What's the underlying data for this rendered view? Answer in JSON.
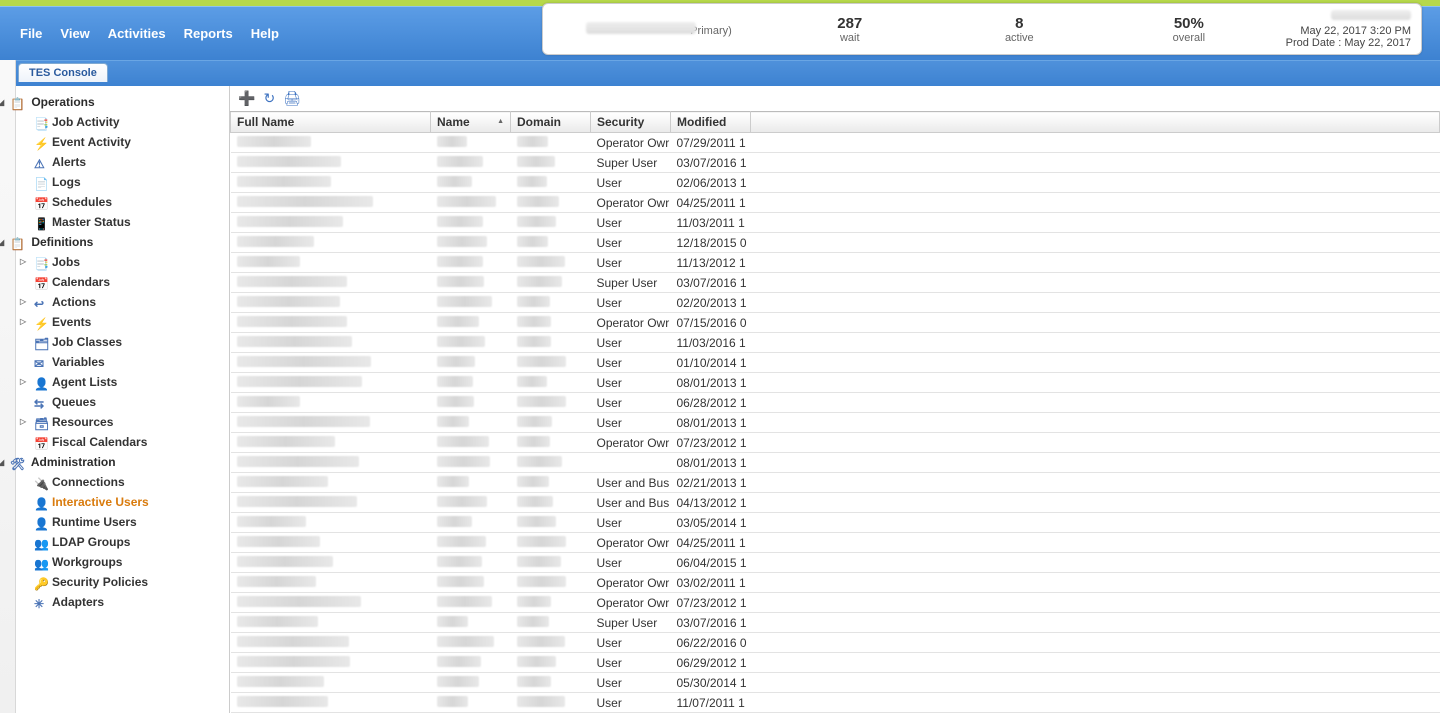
{
  "menu": {
    "file": "File",
    "view": "View",
    "activities": "Activities",
    "reports": "Reports",
    "help": "Help"
  },
  "header": {
    "primary_suffix": "Primary)",
    "wait_num": "287",
    "wait_label": "wait",
    "active_num": "8",
    "active_label": "active",
    "overall_num": "50%",
    "overall_label": "overall",
    "date_line1": "May 22, 2017 3:20 PM",
    "date_line2": "Prod Date : May 22, 2017"
  },
  "tab": "TES Console",
  "tree": {
    "operations": "Operations",
    "job_activity": "Job Activity",
    "event_activity": "Event Activity",
    "alerts": "Alerts",
    "logs": "Logs",
    "schedules": "Schedules",
    "master_status": "Master Status",
    "definitions": "Definitions",
    "jobs": "Jobs",
    "calendars": "Calendars",
    "actions": "Actions",
    "events": "Events",
    "job_classes": "Job Classes",
    "variables": "Variables",
    "agent_lists": "Agent Lists",
    "queues": "Queues",
    "resources": "Resources",
    "fiscal_calendars": "Fiscal Calendars",
    "administration": "Administration",
    "connections": "Connections",
    "interactive_users": "Interactive Users",
    "runtime_users": "Runtime Users",
    "ldap_groups": "LDAP Groups",
    "workgroups": "Workgroups",
    "security_policies": "Security Policies",
    "adapters": "Adapters"
  },
  "columns": {
    "full_name": "Full Name",
    "name": "Name",
    "domain": "Domain",
    "security": "Security",
    "modified": "Modified"
  },
  "rows": [
    {
      "security": "Operator Owr",
      "modified": "07/29/2011 1"
    },
    {
      "security": "Super User",
      "modified": "03/07/2016 1"
    },
    {
      "security": "User",
      "modified": "02/06/2013 1"
    },
    {
      "security": "Operator Owr",
      "modified": "04/25/2011 1"
    },
    {
      "security": "User",
      "modified": "11/03/2011 1"
    },
    {
      "security": "User",
      "modified": "12/18/2015 0"
    },
    {
      "security": "User",
      "modified": "11/13/2012 1"
    },
    {
      "security": "Super User",
      "modified": "03/07/2016 1"
    },
    {
      "security": "User",
      "modified": "02/20/2013 1"
    },
    {
      "security": "Operator Owr",
      "modified": "07/15/2016 0"
    },
    {
      "security": "User",
      "modified": "11/03/2016 1"
    },
    {
      "security": "User",
      "modified": "01/10/2014 1"
    },
    {
      "security": "User",
      "modified": "08/01/2013 1"
    },
    {
      "security": "User",
      "modified": "06/28/2012 1"
    },
    {
      "security": "User",
      "modified": "08/01/2013 1"
    },
    {
      "security": "Operator Owr",
      "modified": "07/23/2012 1"
    },
    {
      "security": "",
      "modified": "08/01/2013 1"
    },
    {
      "security": "User and Bus",
      "modified": "02/21/2013 1"
    },
    {
      "security": "User and Bus",
      "modified": "04/13/2012 1"
    },
    {
      "security": "User",
      "modified": "03/05/2014 1"
    },
    {
      "security": "Operator Owr",
      "modified": "04/25/2011 1"
    },
    {
      "security": "User",
      "modified": "06/04/2015 1"
    },
    {
      "security": "Operator Owr",
      "modified": "03/02/2011 1"
    },
    {
      "security": "Operator Owr",
      "modified": "07/23/2012 1"
    },
    {
      "security": "Super User",
      "modified": "03/07/2016 1"
    },
    {
      "security": "User",
      "modified": "06/22/2016 0"
    },
    {
      "security": "User",
      "modified": "06/29/2012 1"
    },
    {
      "security": "User",
      "modified": "05/30/2014 1"
    },
    {
      "security": "User",
      "modified": "11/07/2011 1"
    }
  ]
}
